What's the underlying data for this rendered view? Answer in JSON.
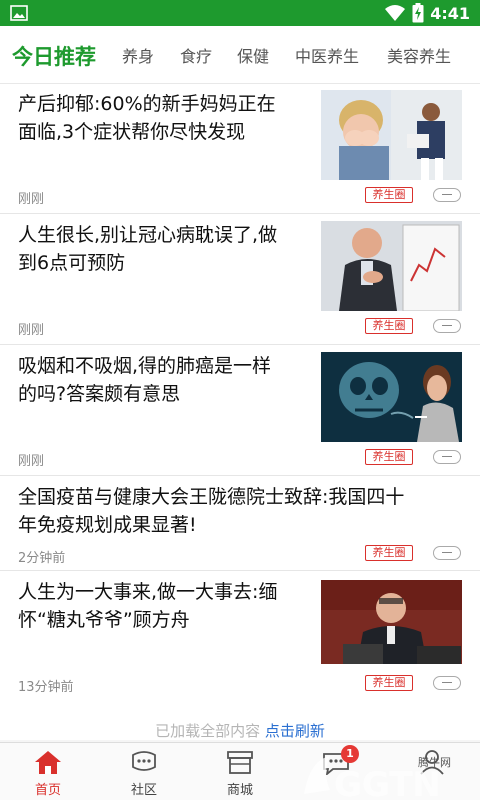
{
  "status_bar": {
    "time": "4:41",
    "left_icon": "image-icon",
    "right_icons": [
      "wifi-icon",
      "battery-charging-icon"
    ]
  },
  "tabs": [
    {
      "label": "今日推荐",
      "active": true
    },
    {
      "label": "养身"
    },
    {
      "label": "食疗"
    },
    {
      "label": "保健"
    },
    {
      "label": "中医养生"
    },
    {
      "label": "美容养生"
    }
  ],
  "feed": [
    {
      "title_line1": "产后抑郁:60%的新手妈妈正在",
      "title_line2": "面临,3个症状帮你尽快发现",
      "time": "刚刚",
      "tag": "养生圈",
      "thumb": "postpartum-mother-photo"
    },
    {
      "title_line1": "人生很长,别让冠心病耽误了,做",
      "title_line2": "到6点可预防",
      "time": "刚刚",
      "tag": "养生圈",
      "thumb": "man-chest-pain-photo"
    },
    {
      "title_line1": "吸烟和不吸烟,得的肺癌是一样",
      "title_line2": "的吗?答案颇有意思",
      "time": "刚刚",
      "tag": "养生圈",
      "thumb": "smoke-skull-woman-photo"
    },
    {
      "title_line1": "全国疫苗与健康大会王陇德院士致辞:我国四十",
      "title_line2": "年免疫规划成果显著!",
      "time": "2分钟前",
      "tag": "养生圈"
    },
    {
      "title_line1": "人生为一大事来,做一大事去:缅",
      "title_line2": "怀“糖丸爷爷”顾方舟",
      "time": "13分钟前",
      "tag": "养生圈",
      "thumb": "speaker-at-podium-photo"
    }
  ],
  "load_more": {
    "text": "已加载全部内容",
    "link": "点击刷新"
  },
  "bottom_nav": [
    {
      "label": "首页",
      "icon": "home-icon",
      "active": true
    },
    {
      "label": "社区",
      "icon": "community-icon"
    },
    {
      "label": "商城",
      "icon": "store-icon"
    },
    {
      "label": "",
      "icon": "messages-icon",
      "badge": "1"
    },
    {
      "label": "",
      "icon": "profile-icon"
    }
  ],
  "watermark": {
    "brand": "GGTN",
    "sub": "腾牛网"
  },
  "colors": {
    "brand_green": "#1e9a2e",
    "accent_red": "#d9302c",
    "link_blue": "#2a6fd1"
  }
}
